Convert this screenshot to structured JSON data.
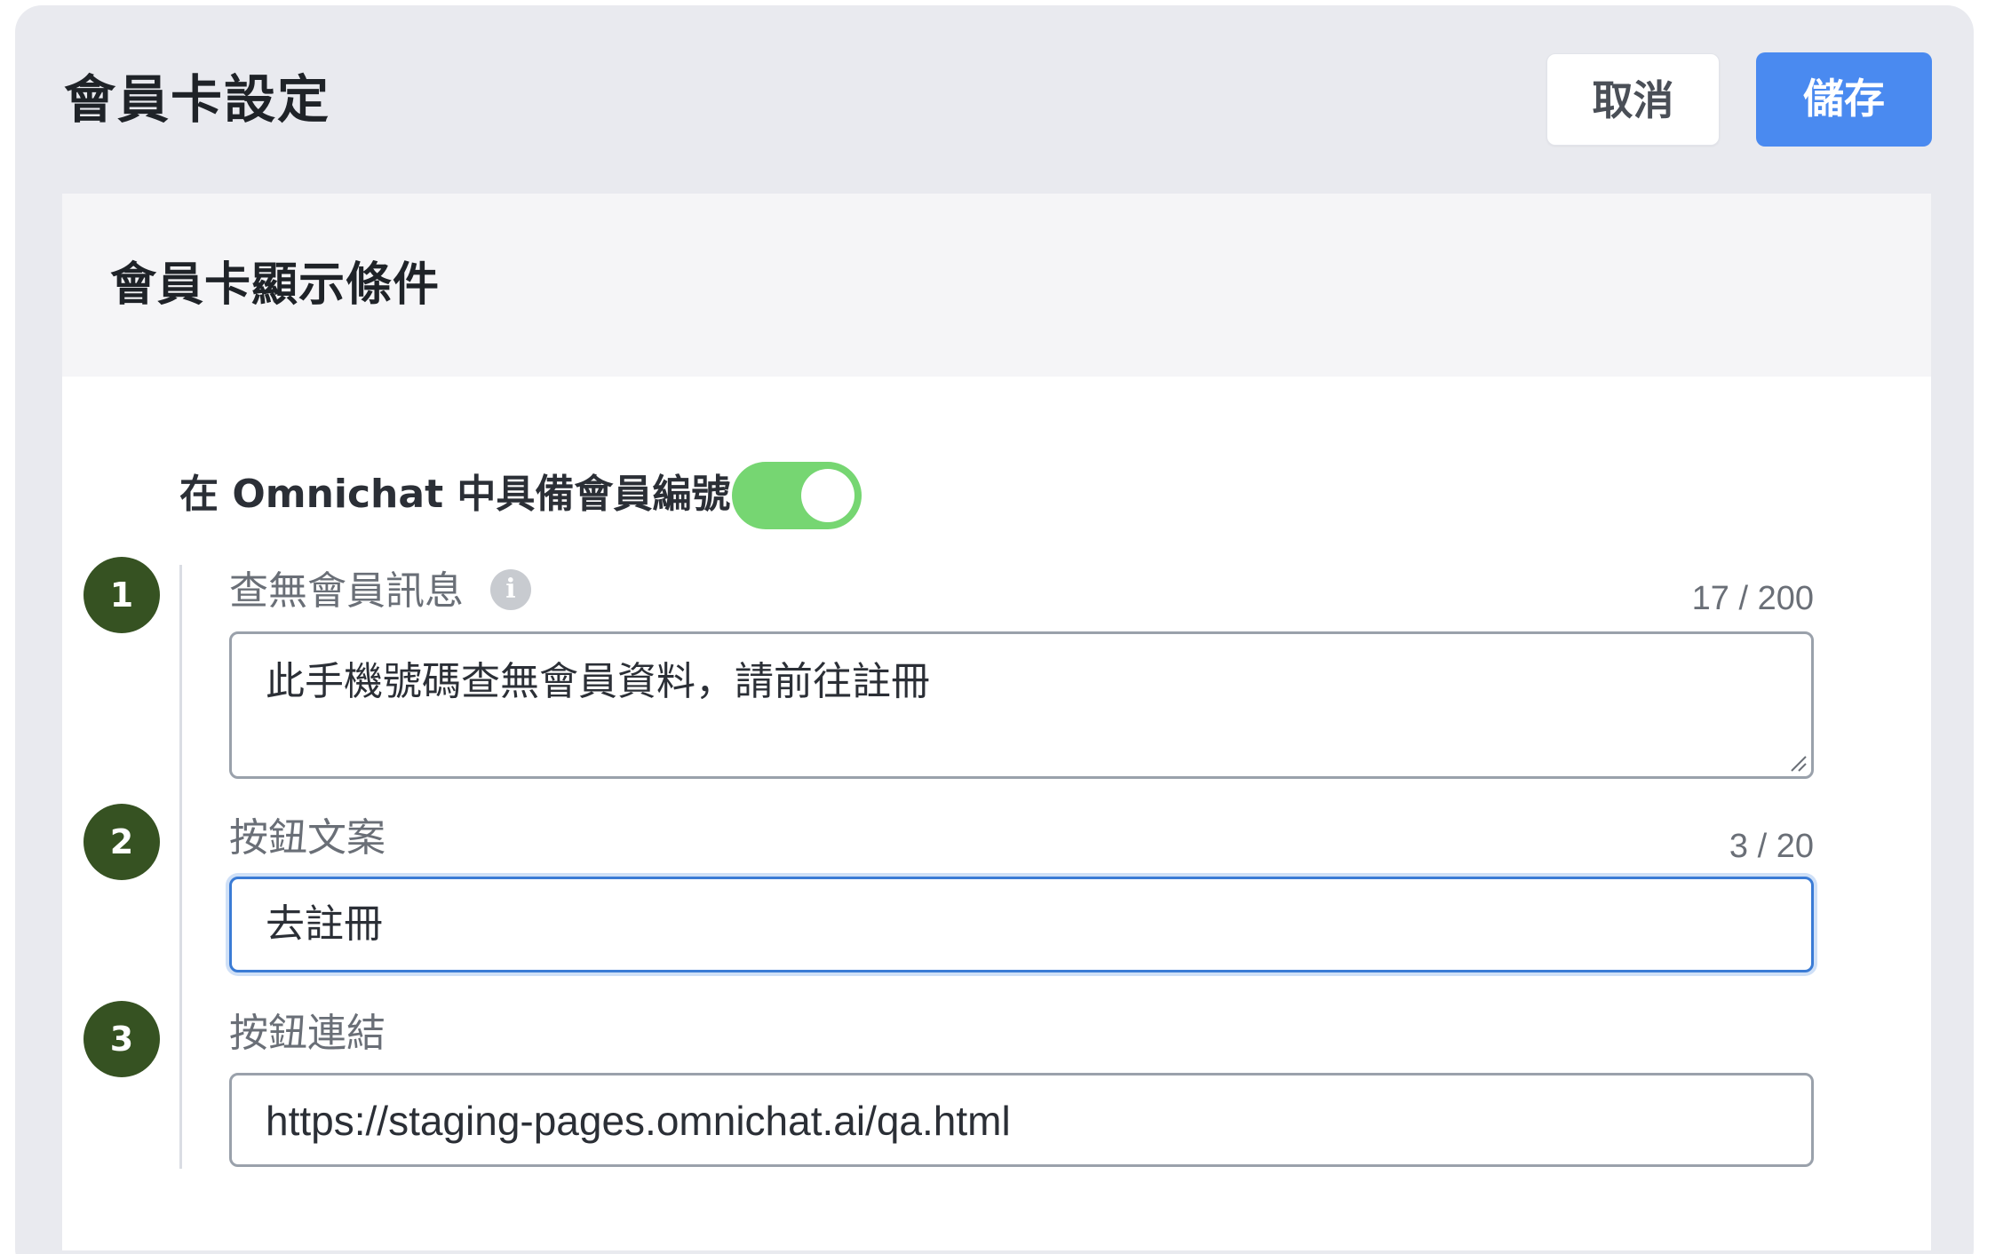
{
  "header": {
    "title": "會員卡設定",
    "cancel_label": "取消",
    "save_label": "儲存"
  },
  "section": {
    "title": "會員卡顯示條件",
    "toggle": {
      "label": "在 Omnichat 中具備會員編號",
      "on": true
    },
    "fields": [
      {
        "step": "1",
        "label": "查無會員訊息",
        "has_info_icon": true,
        "counter": "17 / 200",
        "value": "此手機號碼查無會員資料，請前往註冊"
      },
      {
        "step": "2",
        "label": "按鈕文案",
        "counter": "3 / 20",
        "value": "去註冊"
      },
      {
        "step": "3",
        "label": "按鈕連結",
        "value": "https://staging-pages.omnichat.ai/qa.html"
      }
    ]
  },
  "colors": {
    "panel_bg": "#e9eaef",
    "primary": "#4a8af0",
    "toggle_on": "#76d672",
    "step_badge": "#365222",
    "focus_border": "#3a7bd5"
  },
  "icons": {
    "info": "info-icon"
  }
}
